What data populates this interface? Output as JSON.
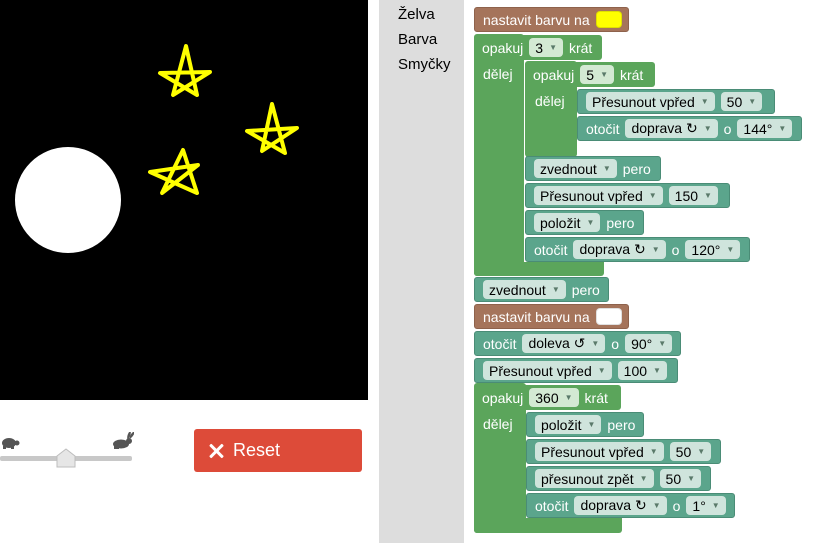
{
  "toolbox": {
    "categories": [
      "Želva",
      "Barva",
      "Smyčky"
    ]
  },
  "speed_slider": {
    "value": 0.5,
    "slow_icon": "turtle-icon",
    "fast_icon": "rabbit-icon"
  },
  "reset": {
    "label": "Reset",
    "icon": "close-icon",
    "color": "#dd4b39"
  },
  "colors": {
    "yellow": "#ffff00",
    "white": "#ffffff",
    "turtle_block": "#5ba58c",
    "loop_block": "#5ba55b",
    "color_block": "#a5745b"
  },
  "blocks": {
    "set_color_1": {
      "label": "nastavit barvu na",
      "color": "#ffff00"
    },
    "repeat_outer": {
      "label": "opakuj",
      "count": "3",
      "suffix": "krát",
      "do": "dělej"
    },
    "repeat_inner": {
      "label": "opakuj",
      "count": "5",
      "suffix": "krát",
      "do": "dělej"
    },
    "move_50": {
      "dropdown": "Přesunout vpřed",
      "value": "50"
    },
    "turn_144": {
      "label": "otočit",
      "direction": "doprava ↻",
      "o": "o",
      "angle": "144°"
    },
    "pen_up_1": {
      "dropdown": "zvednout",
      "suffix": "pero"
    },
    "move_150": {
      "dropdown": "Přesunout vpřed",
      "value": "150"
    },
    "pen_down_1": {
      "dropdown": "položit",
      "suffix": "pero"
    },
    "turn_120": {
      "label": "otočit",
      "direction": "doprava ↻",
      "o": "o",
      "angle": "120°"
    },
    "pen_up_2": {
      "dropdown": "zvednout",
      "suffix": "pero"
    },
    "set_color_2": {
      "label": "nastavit barvu na",
      "color": "#ffffff"
    },
    "turn_90": {
      "label": "otočit",
      "direction": "doleva ↺",
      "o": "o",
      "angle": "90°"
    },
    "move_100": {
      "dropdown": "Přesunout vpřed",
      "value": "100"
    },
    "repeat_360": {
      "label": "opakuj",
      "count": "360",
      "suffix": "krát",
      "do": "dělej"
    },
    "pen_down_2": {
      "dropdown": "položit",
      "suffix": "pero"
    },
    "move_50b": {
      "dropdown": "Přesunout vpřed",
      "value": "50"
    },
    "move_back_50": {
      "dropdown": "přesunout zpět",
      "value": "50"
    },
    "turn_1": {
      "label": "otočit",
      "direction": "doprava ↻",
      "o": "o",
      "angle": "1°"
    }
  }
}
